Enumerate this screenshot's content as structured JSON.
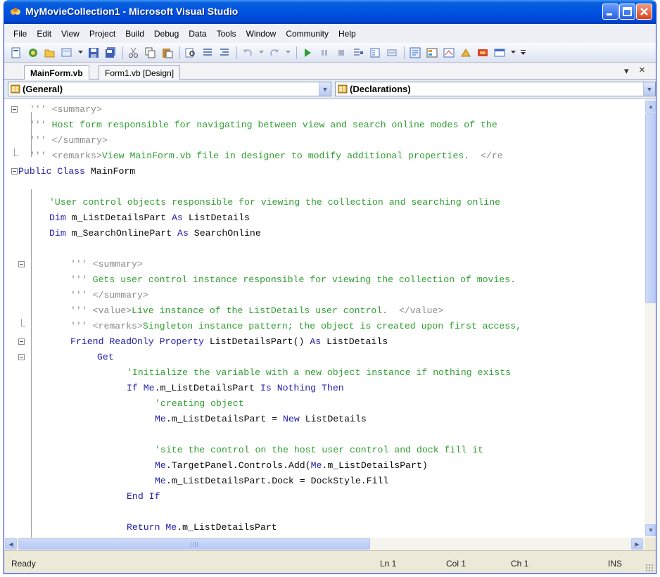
{
  "window": {
    "title": "MyMovieCollection1 - Microsoft Visual Studio"
  },
  "menu": [
    "File",
    "Edit",
    "View",
    "Project",
    "Build",
    "Debug",
    "Data",
    "Tools",
    "Window",
    "Community",
    "Help"
  ],
  "toolbar": {
    "icons": [
      "new-project-icon",
      "add-item-icon",
      "open-file-icon",
      "add-new-item-icon",
      "save-icon",
      "save-all-icon",
      "cut-icon",
      "copy-icon",
      "paste-icon",
      "find-icon",
      "comment-icon",
      "uncomment-icon",
      "undo-icon",
      "redo-icon",
      "start-debugging-icon",
      "break-all-icon",
      "stop-debugging-icon",
      "step-into-icon",
      "step-over-icon",
      "step-out-icon",
      "solution-explorer-icon",
      "properties-icon",
      "object-browser-icon",
      "toolbox-icon",
      "class-view-icon",
      "start-page-icon"
    ]
  },
  "tabs": {
    "active": "MainForm.vb",
    "inactive": "Form1.vb [Design]",
    "dropdown_glyph": "▾",
    "close_glyph": "×"
  },
  "nav": {
    "left_combo": "(General)",
    "right_combo": "(Declarations)"
  },
  "code": {
    "lines": [
      {
        "segs": [
          {
            "t": "''' ",
            "c": "xd"
          },
          {
            "t": "<summary>",
            "c": "xd"
          }
        ]
      },
      {
        "segs": [
          {
            "t": "''' ",
            "c": "xd"
          },
          {
            "t": "Host form responsible for navigating between view and search online modes of the",
            "c": "cm"
          }
        ]
      },
      {
        "segs": [
          {
            "t": "''' ",
            "c": "xd"
          },
          {
            "t": "</summary>",
            "c": "xd"
          }
        ]
      },
      {
        "segs": [
          {
            "t": "''' ",
            "c": "xd"
          },
          {
            "t": "<remarks>",
            "c": "xd"
          },
          {
            "t": "View MainForm.vb file in designer to modify additional properties.  ",
            "c": "cm"
          },
          {
            "t": "</re",
            "c": "xd"
          }
        ]
      },
      {
        "segs": [
          {
            "t": "Public Class ",
            "c": "kw"
          },
          {
            "t": "MainForm",
            "c": "tx"
          }
        ]
      },
      {
        "segs": []
      },
      {
        "segs": [
          {
            "t": "'User control objects responsible for viewing the collection and searching online",
            "c": "cm"
          }
        ]
      },
      {
        "segs": [
          {
            "t": "Dim ",
            "c": "kw"
          },
          {
            "t": "m_ListDetailsPart ",
            "c": "tx"
          },
          {
            "t": "As ",
            "c": "kw"
          },
          {
            "t": "ListDetails",
            "c": "tx"
          }
        ]
      },
      {
        "segs": [
          {
            "t": "Dim ",
            "c": "kw"
          },
          {
            "t": "m_SearchOnlinePart ",
            "c": "tx"
          },
          {
            "t": "As ",
            "c": "kw"
          },
          {
            "t": "SearchOnline",
            "c": "tx"
          }
        ]
      },
      {
        "segs": []
      },
      {
        "segs": [
          {
            "t": "''' ",
            "c": "xd"
          },
          {
            "t": "<summary>",
            "c": "xd"
          }
        ]
      },
      {
        "segs": [
          {
            "t": "''' ",
            "c": "xd"
          },
          {
            "t": "Gets user control instance responsible for viewing the collection of movies.",
            "c": "cm"
          }
        ]
      },
      {
        "segs": [
          {
            "t": "''' ",
            "c": "xd"
          },
          {
            "t": "</summary>",
            "c": "xd"
          }
        ]
      },
      {
        "segs": [
          {
            "t": "''' ",
            "c": "xd"
          },
          {
            "t": "<value>",
            "c": "xd"
          },
          {
            "t": "Live instance of the ListDetails user control.  ",
            "c": "cm"
          },
          {
            "t": "</value>",
            "c": "xd"
          }
        ]
      },
      {
        "segs": [
          {
            "t": "''' ",
            "c": "xd"
          },
          {
            "t": "<remarks>",
            "c": "xd"
          },
          {
            "t": "Singleton instance pattern; the object is created upon first access,",
            "c": "cm"
          }
        ]
      },
      {
        "segs": [
          {
            "t": "Friend ReadOnly Property ",
            "c": "kw"
          },
          {
            "t": "ListDetailsPart() ",
            "c": "tx"
          },
          {
            "t": "As ",
            "c": "kw"
          },
          {
            "t": "ListDetails",
            "c": "tx"
          }
        ]
      },
      {
        "segs": [
          {
            "t": "Get",
            "c": "kw"
          }
        ]
      },
      {
        "segs": [
          {
            "t": "'Initialize the variable with a new object instance if nothing exists",
            "c": "cm"
          }
        ]
      },
      {
        "segs": [
          {
            "t": "If Me",
            "c": "kw"
          },
          {
            "t": ".m_ListDetailsPart ",
            "c": "tx"
          },
          {
            "t": "Is Nothing Then",
            "c": "kw"
          }
        ]
      },
      {
        "segs": [
          {
            "t": "'creating object",
            "c": "cm"
          }
        ]
      },
      {
        "segs": [
          {
            "t": "Me",
            "c": "kw"
          },
          {
            "t": ".m_ListDetailsPart = ",
            "c": "tx"
          },
          {
            "t": "New ",
            "c": "kw"
          },
          {
            "t": "ListDetails",
            "c": "tx"
          }
        ]
      },
      {
        "segs": []
      },
      {
        "segs": [
          {
            "t": "'site the control on the host user control and dock fill it",
            "c": "cm"
          }
        ]
      },
      {
        "segs": [
          {
            "t": "Me",
            "c": "kw"
          },
          {
            "t": ".TargetPanel.Controls.Add(",
            "c": "tx"
          },
          {
            "t": "Me",
            "c": "kw"
          },
          {
            "t": ".m_ListDetailsPart)",
            "c": "tx"
          }
        ]
      },
      {
        "segs": [
          {
            "t": "Me",
            "c": "kw"
          },
          {
            "t": ".m_ListDetailsPart.Dock = DockStyle.Fill",
            "c": "tx"
          }
        ]
      },
      {
        "segs": [
          {
            "t": "End If",
            "c": "kw"
          }
        ]
      },
      {
        "segs": []
      },
      {
        "segs": [
          {
            "t": "Return Me",
            "c": "kw"
          },
          {
            "t": ".m_ListDetailsPart",
            "c": "tx"
          }
        ]
      }
    ]
  },
  "status": {
    "ready": "Ready",
    "ln": "Ln 1",
    "col": "Col 1",
    "ch": "Ch 1",
    "mode": "INS"
  },
  "colors": {
    "keyword": "#1f1fa8",
    "comment": "#2f9e2f",
    "xmldoc": "#8b8b8b",
    "titlebar": "#0054e3"
  }
}
